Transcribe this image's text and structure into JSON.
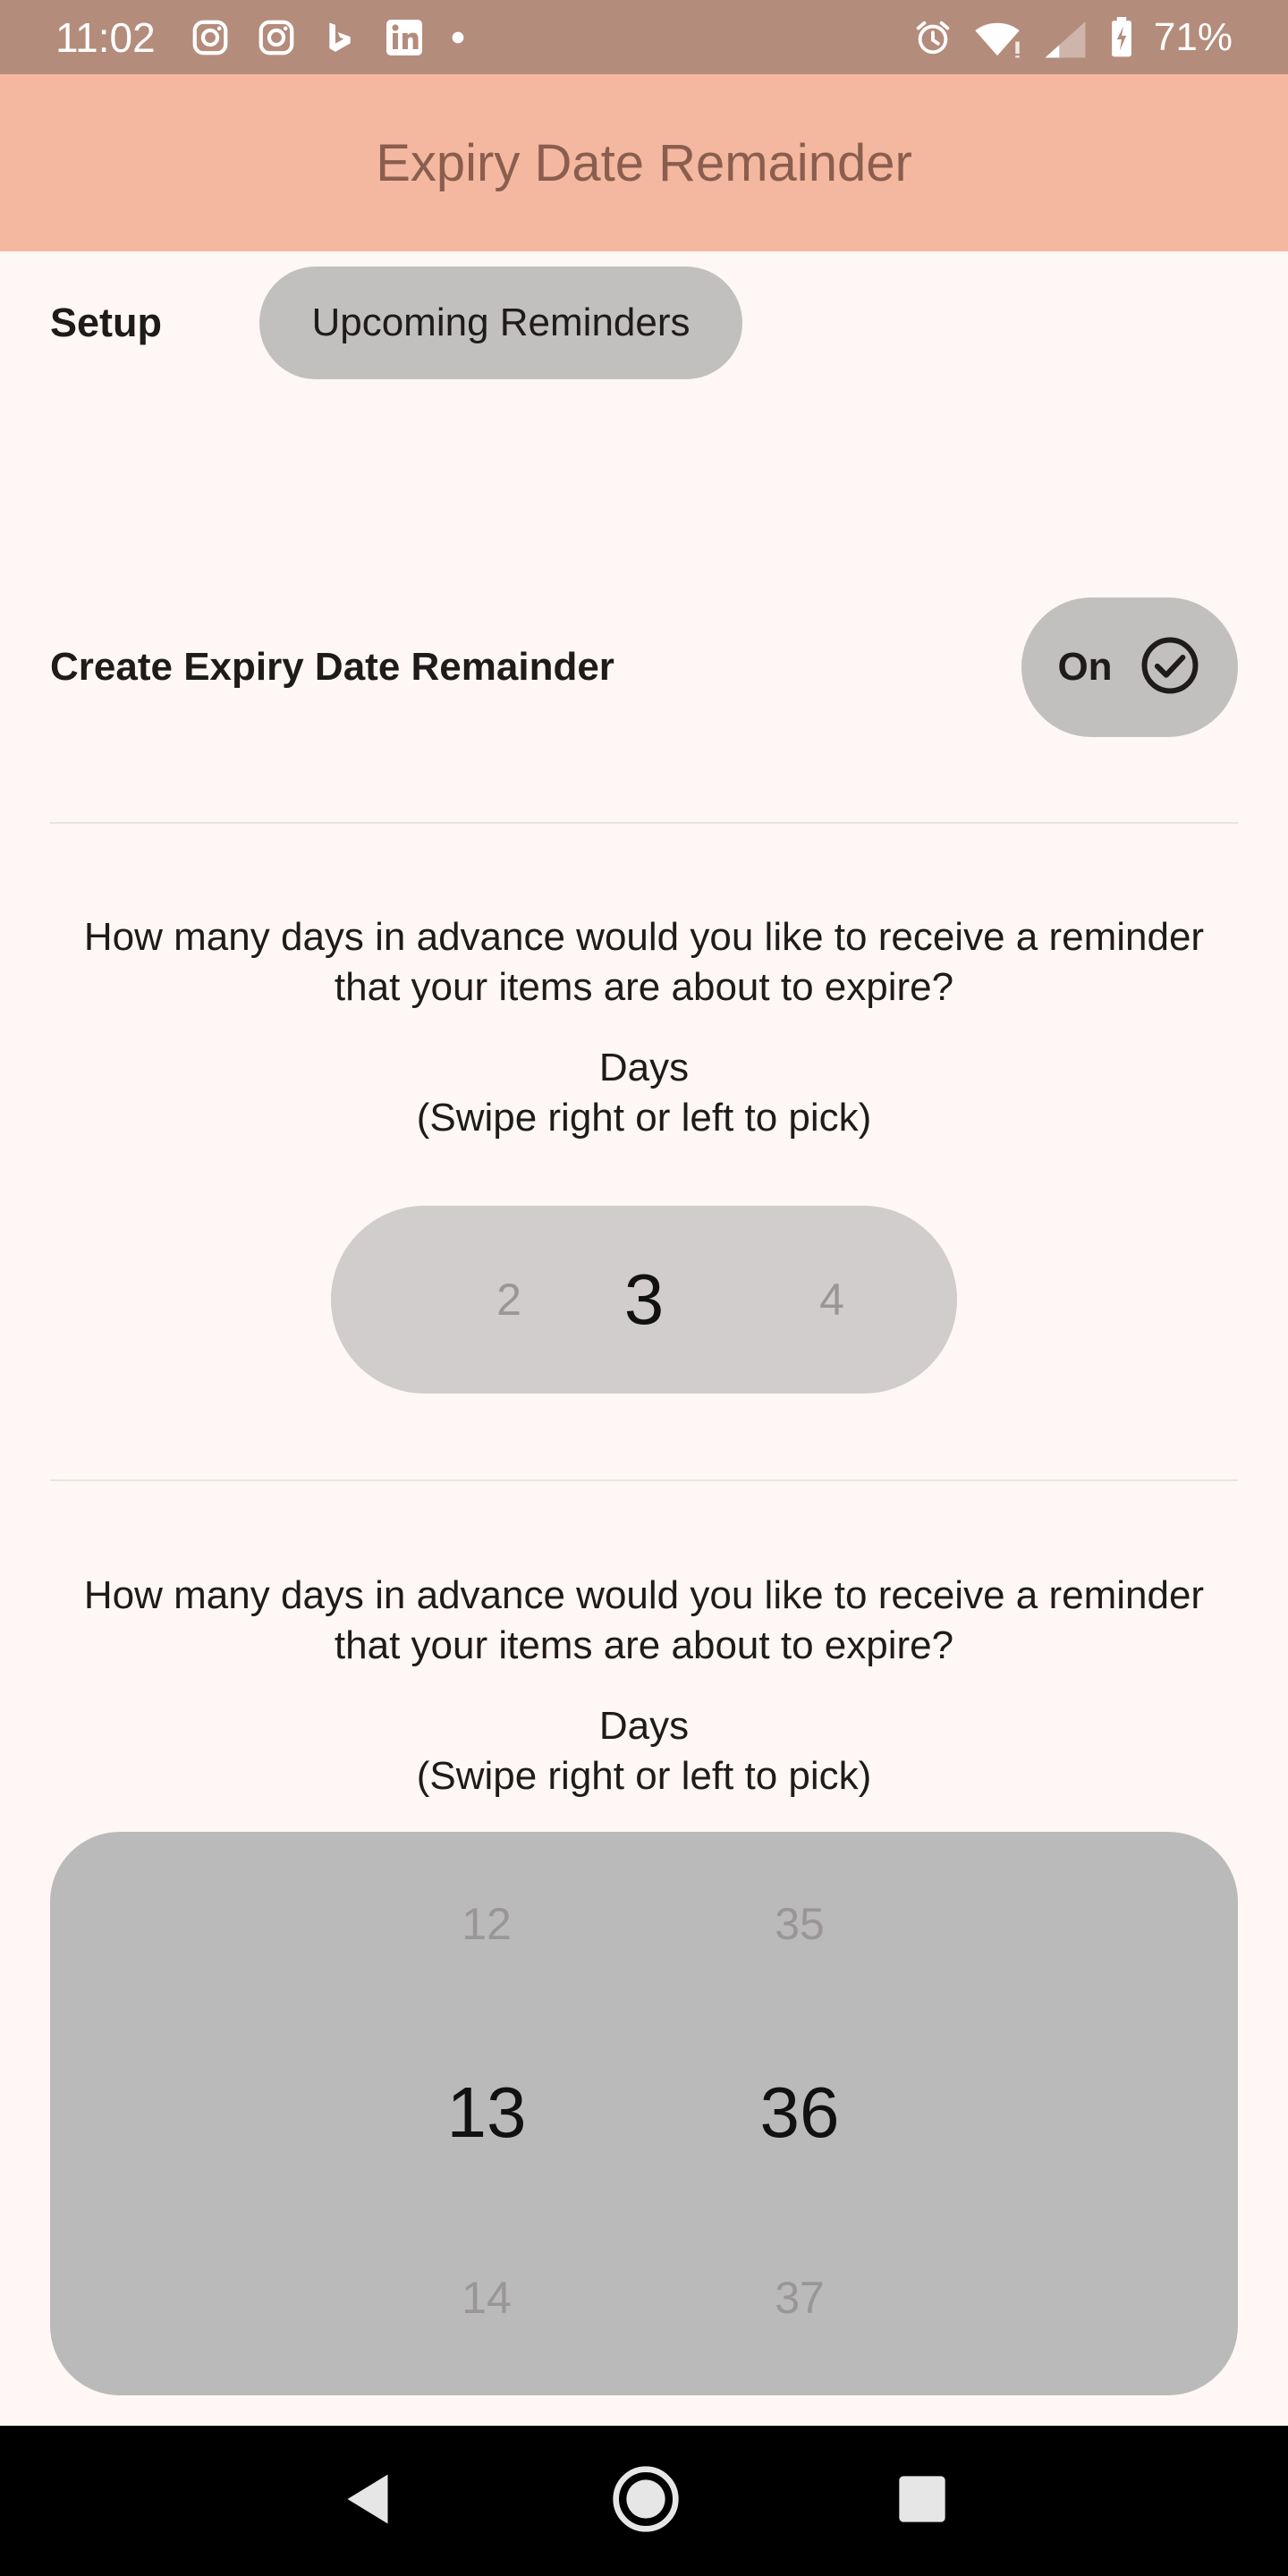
{
  "status_bar": {
    "time": "11:02",
    "left_icons": [
      "instagram-icon",
      "instagram-icon",
      "bing-icon",
      "linkedin-icon",
      "dot-icon"
    ],
    "right_icons": [
      "alarm-icon",
      "wifi-icon",
      "signal-icon",
      "battery-charging-icon"
    ],
    "battery": "71%"
  },
  "app_bar": {
    "title": "Expiry Date Remainder"
  },
  "tabs": [
    {
      "label": "Setup",
      "selected": false
    },
    {
      "label": "Upcoming Reminders",
      "selected": true
    }
  ],
  "create_section": {
    "label": "Create Expiry Date Remainder",
    "toggle_label": "On",
    "toggle_icon": "check-circle-icon"
  },
  "days_section_1": {
    "question": "How many days in advance would you like to receive a reminder that your items are about to expire?",
    "days_label": "Days",
    "hint": "(Swipe right or left to pick)",
    "picker": {
      "prev": "2",
      "current": "3",
      "next": "4"
    }
  },
  "days_section_2": {
    "question": "How many days in advance would you like to receive a reminder that your items are about to expire?",
    "days_label": "Days",
    "hint": "(Swipe right or left to pick)",
    "picker_col1": {
      "prev": "12",
      "current": "13",
      "next": "14"
    },
    "picker_col2": {
      "prev": "35",
      "current": "36",
      "next": "37"
    }
  },
  "nav_bar": {
    "icons": [
      "back-icon",
      "home-icon",
      "recents-icon"
    ]
  },
  "colors": {
    "status_bar": "#B48C7C",
    "app_bar": "#F4B7A0",
    "title_text": "#8A5E4E",
    "background": "#FEF7F5",
    "chip": "#C2BFBF",
    "picker_small": "#D1CDCC",
    "picker_big": "#BABABA"
  }
}
